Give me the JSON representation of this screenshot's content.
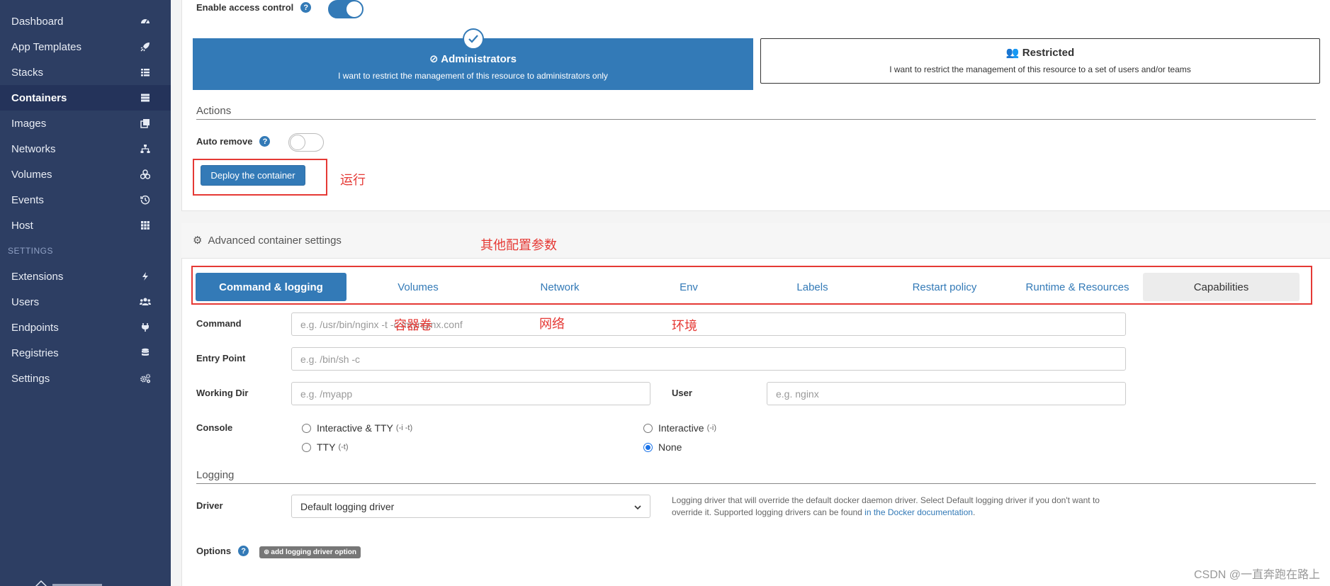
{
  "sidebar": {
    "items": [
      {
        "label": "Dashboard",
        "icon": "dashboard-icon"
      },
      {
        "label": "App Templates",
        "icon": "rocket-icon"
      },
      {
        "label": "Stacks",
        "icon": "list-icon"
      },
      {
        "label": "Containers",
        "icon": "server-icon"
      },
      {
        "label": "Images",
        "icon": "clone-icon"
      },
      {
        "label": "Networks",
        "icon": "sitemap-icon"
      },
      {
        "label": "Volumes",
        "icon": "cubes-icon"
      },
      {
        "label": "Events",
        "icon": "history-icon"
      },
      {
        "label": "Host",
        "icon": "grid-icon"
      }
    ],
    "section_label": "SETTINGS",
    "settings_items": [
      {
        "label": "Extensions",
        "icon": "bolt-icon"
      },
      {
        "label": "Users",
        "icon": "users-icon"
      },
      {
        "label": "Endpoints",
        "icon": "plug-icon"
      },
      {
        "label": "Registries",
        "icon": "database-icon"
      },
      {
        "label": "Settings",
        "icon": "cogs-icon"
      }
    ],
    "active": "Containers"
  },
  "access": {
    "enable_label": "Enable access control",
    "enabled": true,
    "admin_title": "Administrators",
    "admin_desc": "I want to restrict the management of this resource to administrators only",
    "restricted_title": "Restricted",
    "restricted_desc": "I want to restrict the management of this resource to a set of users and/or teams"
  },
  "actions": {
    "title": "Actions",
    "auto_remove_label": "Auto remove",
    "auto_remove": false,
    "deploy_label": "Deploy the container"
  },
  "annotations": {
    "run": "运行",
    "other_config": "其他配置参数",
    "volumes": "容器卷",
    "network": "网络",
    "env": "环境"
  },
  "advanced": {
    "title": "Advanced container settings",
    "tabs": [
      "Command & logging",
      "Volumes",
      "Network",
      "Env",
      "Labels",
      "Restart policy",
      "Runtime & Resources",
      "Capabilities"
    ],
    "active_tab": "Command & logging"
  },
  "command_form": {
    "command_label": "Command",
    "command_placeholder": "e.g. /usr/bin/nginx -t -c /mynginx.conf",
    "entry_label": "Entry Point",
    "entry_placeholder": "e.g. /bin/sh -c",
    "workdir_label": "Working Dir",
    "workdir_placeholder": "e.g. /myapp",
    "user_label": "User",
    "user_placeholder": "e.g. nginx",
    "console_label": "Console",
    "console_options": [
      {
        "label": "Interactive & TTY",
        "hint": "(-i -t)"
      },
      {
        "label": "Interactive",
        "hint": "(-i)"
      },
      {
        "label": "TTY",
        "hint": "(-t)"
      },
      {
        "label": "None",
        "hint": ""
      }
    ],
    "console_selected": "None"
  },
  "logging": {
    "title": "Logging",
    "driver_label": "Driver",
    "driver_value": "Default logging driver",
    "help_text": "Logging driver that will override the default docker daemon driver. Select Default logging driver if you don't want to override it. Supported logging drivers can be found ",
    "help_link": "in the Docker documentation",
    "help_end": ".",
    "options_label": "Options",
    "add_option_label": "add logging driver option"
  },
  "watermark": "CSDN @一直奔跑在路上"
}
